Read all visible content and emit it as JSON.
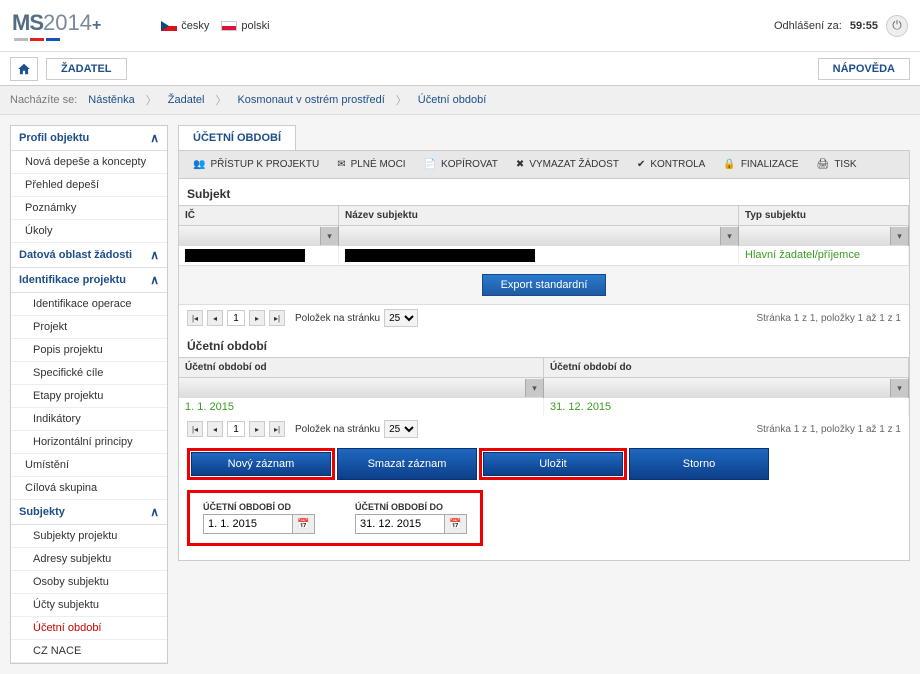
{
  "header": {
    "logo_prefix": "MS",
    "logo_year": "2014",
    "logo_plus": "+",
    "lang_cs": "česky",
    "lang_pl": "polski",
    "logout_label": "Odhlášení za:",
    "logout_time": "59:55"
  },
  "toolbar": {
    "zadatel": "ŽADATEL",
    "napoveda": "NÁPOVĚDA"
  },
  "breadcrumb": {
    "label": "Nacházíte se:",
    "items": [
      "Nástěnka",
      "Žadatel",
      "Kosmonaut v ostrém prostředí",
      "Účetní období"
    ]
  },
  "sidebar": {
    "g1": {
      "title": "Profil objektu",
      "items": [
        "Nová depeše a koncepty",
        "Přehled depeší",
        "Poznámky",
        "Úkoly"
      ]
    },
    "g2": {
      "title": "Datová oblast žádosti"
    },
    "g3": {
      "title": "Identifikace projektu",
      "items": [
        "Identifikace operace",
        "Projekt",
        "Popis projektu",
        "Specifické cíle",
        "Etapy projektu",
        "Indikátory",
        "Horizontální principy"
      ]
    },
    "loose1": "Umístění",
    "loose2": "Cílová skupina",
    "g4": {
      "title": "Subjekty",
      "items": [
        "Subjekty projektu",
        "Adresy subjektu",
        "Osoby subjektu",
        "Účty subjektu",
        "Účetní období",
        "CZ NACE"
      ]
    }
  },
  "tab": {
    "title": "ÚČETNÍ OBDOBÍ"
  },
  "actionbar": {
    "pristup": "PŘÍSTUP K PROJEKTU",
    "plne": "PLNÉ MOCI",
    "kopirovat": "KOPÍROVAT",
    "vymazat": "VYMAZAT ŽÁDOST",
    "kontrola": "KONTROLA",
    "finalizace": "FINALIZACE",
    "tisk": "TISK"
  },
  "subjekt": {
    "title": "Subjekt",
    "col_ic": "IČ",
    "col_nazev": "Název subjektu",
    "col_typ": "Typ subjektu",
    "typ_value": "Hlavní žadatel/příjemce",
    "export": "Export standardní"
  },
  "pager": {
    "page": "1",
    "per_label": "Položek na stránku",
    "per_value": "25",
    "info": "Stránka 1 z 1, položky 1 až 1 z 1"
  },
  "ucetni": {
    "title": "Účetní období",
    "col_od": "Účetní období od",
    "col_do": "Účetní období do",
    "val_od": "1. 1. 2015",
    "val_do": "31. 12. 2015"
  },
  "buttons": {
    "novy": "Nový záznam",
    "smazat": "Smazat záznam",
    "ulozit": "Uložit",
    "storno": "Storno"
  },
  "form": {
    "label_od": "ÚČETNÍ OBDOBÍ OD",
    "label_do": "ÚČETNÍ OBDOBÍ DO",
    "val_od": "1. 1. 2015",
    "val_do": "31. 12. 2015"
  }
}
